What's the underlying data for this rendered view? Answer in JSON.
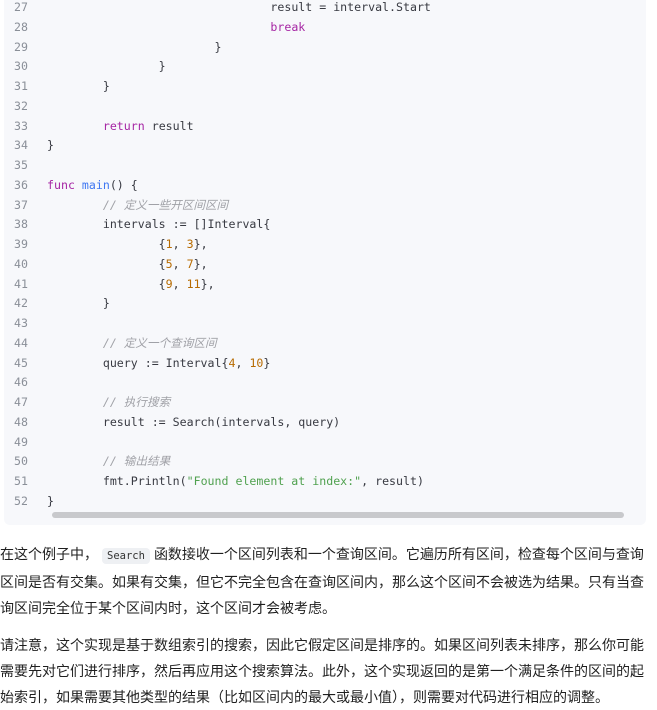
{
  "code": {
    "lines": [
      {
        "n": "27",
        "t": [
          [
            "",
            "                                "
          ],
          [
            "",
            "result = interval.Start"
          ]
        ]
      },
      {
        "n": "28",
        "t": [
          [
            "",
            "                                "
          ],
          [
            "kw",
            "break"
          ]
        ]
      },
      {
        "n": "29",
        "t": [
          [
            "",
            "                        }"
          ]
        ]
      },
      {
        "n": "30",
        "t": [
          [
            "",
            "                }"
          ]
        ]
      },
      {
        "n": "31",
        "t": [
          [
            "",
            "        }"
          ]
        ]
      },
      {
        "n": "32",
        "t": []
      },
      {
        "n": "33",
        "t": [
          [
            "",
            "        "
          ],
          [
            "kw",
            "return"
          ],
          [
            "",
            " result"
          ]
        ]
      },
      {
        "n": "34",
        "t": [
          [
            "",
            "}"
          ]
        ]
      },
      {
        "n": "35",
        "t": []
      },
      {
        "n": "36",
        "t": [
          [
            "kw",
            "func"
          ],
          [
            "",
            " "
          ],
          [
            "fn",
            "main"
          ],
          [
            "",
            "() {"
          ]
        ]
      },
      {
        "n": "37",
        "t": [
          [
            "",
            "        "
          ],
          [
            "cm",
            "// 定义一些开区间区间"
          ]
        ]
      },
      {
        "n": "38",
        "t": [
          [
            "",
            "        intervals := []Interval{"
          ]
        ]
      },
      {
        "n": "39",
        "t": [
          [
            "",
            "                {"
          ],
          [
            "num",
            "1"
          ],
          [
            "",
            ", "
          ],
          [
            "num",
            "3"
          ],
          [
            "",
            "},"
          ]
        ]
      },
      {
        "n": "40",
        "t": [
          [
            "",
            "                {"
          ],
          [
            "num",
            "5"
          ],
          [
            "",
            ", "
          ],
          [
            "num",
            "7"
          ],
          [
            "",
            "},"
          ]
        ]
      },
      {
        "n": "41",
        "t": [
          [
            "",
            "                {"
          ],
          [
            "num",
            "9"
          ],
          [
            "",
            ", "
          ],
          [
            "num",
            "11"
          ],
          [
            "",
            "},"
          ]
        ]
      },
      {
        "n": "42",
        "t": [
          [
            "",
            "        }"
          ]
        ]
      },
      {
        "n": "43",
        "t": []
      },
      {
        "n": "44",
        "t": [
          [
            "",
            "        "
          ],
          [
            "cm",
            "// 定义一个查询区间"
          ]
        ]
      },
      {
        "n": "45",
        "t": [
          [
            "",
            "        query := Interval{"
          ],
          [
            "num",
            "4"
          ],
          [
            "",
            ", "
          ],
          [
            "num",
            "10"
          ],
          [
            "",
            "}"
          ]
        ]
      },
      {
        "n": "46",
        "t": []
      },
      {
        "n": "47",
        "t": [
          [
            "",
            "        "
          ],
          [
            "cm",
            "// 执行搜索"
          ]
        ]
      },
      {
        "n": "48",
        "t": [
          [
            "",
            "        result := Search(intervals, query)"
          ]
        ]
      },
      {
        "n": "49",
        "t": []
      },
      {
        "n": "50",
        "t": [
          [
            "",
            "        "
          ],
          [
            "cm",
            "// 输出结果"
          ]
        ]
      },
      {
        "n": "51",
        "t": [
          [
            "",
            "        fmt.Println("
          ],
          [
            "str",
            "\"Found element at index:\""
          ],
          [
            "",
            ", result)"
          ]
        ]
      },
      {
        "n": "52",
        "t": [
          [
            "",
            "}"
          ]
        ]
      }
    ]
  },
  "paragraphs": {
    "p1_before": "在这个例子中，",
    "p1_code": "Search",
    "p1_after": "函数接收一个区间列表和一个查询区间。它遍历所有区间，检查每个区间与查询区间是否有交集。如果有交集，但它不完全包含在查询区间内，那么这个区间不会被选为结果。只有当查询区间完全位于某个区间内时，这个区间才会被考虑。",
    "p2": "请注意，这个实现是基于数组索引的搜索，因此它假定区间是排序的。如果区间列表未排序，那么你可能需要先对它们进行排序，然后再应用这个搜索算法。此外，这个实现返回的是第一个满足条件的区间的起始索引，如果需要其他类型的结果（比如区间内的最大或最小值），则需要对代码进行相应的调整。"
  },
  "colors": {
    "keyword": "#a626a4",
    "function": "#4078f2",
    "comment": "#a0a1a7",
    "string": "#50a14f",
    "number": "#b76b01"
  }
}
